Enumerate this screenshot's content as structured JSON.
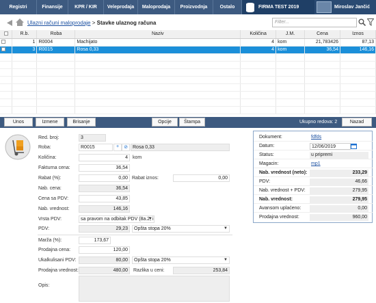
{
  "nav": [
    "Registri",
    "Finansije",
    "KPR / KIR",
    "Veleprodaja",
    "Maloprodaja",
    "Proizvodnja",
    "Ostalo"
  ],
  "firm": "FIRMA TEST 2019",
  "user": "Miroslav Jančić",
  "breadcrumb": {
    "link": "Ulazni računi maloprodaje",
    "sep": ">",
    "current": "Stavke ulaznog računa"
  },
  "filter_placeholder": "Filter...",
  "columns": [
    "R.b.",
    "Roba",
    "Naziv",
    "Količina",
    "J.M.",
    "Cena",
    "Iznos"
  ],
  "rows": [
    {
      "rb": "1",
      "roba": "R0004",
      "naziv": "Machijato",
      "kol": "4",
      "jm": "kom",
      "cena": "21,783426",
      "iznos": "87,13"
    },
    {
      "rb": "3",
      "roba": "R0015",
      "naziv": "Rosa 0,33",
      "kol": "4",
      "jm": "kom",
      "cena": "36,54",
      "iznos": "146,16"
    }
  ],
  "actions": {
    "unos": "Unos",
    "izmene": "Izmene",
    "brisanje": "Brisanje",
    "opcije": "Opcije",
    "stampa": "Štampa",
    "nazad": "Nazad",
    "total": "Ukupno redova: 2"
  },
  "form": {
    "red_broj_l": "Red. broj:",
    "red_broj": "3",
    "roba_l": "Roba:",
    "roba": "R0015",
    "roba_naziv": "Rosa 0,33",
    "kolicina_l": "Količina:",
    "kolicina": "4",
    "jm": "kom",
    "fakt_cena_l": "Fakturna cena:",
    "fakt_cena": "36,54",
    "rabat_pct_l": "Rabat (%):",
    "rabat_pct": "0,00",
    "rabat_iznos_l": "Rabat iznos:",
    "rabat_iznos": "0,00",
    "nab_cena_l": "Nab. cena:",
    "nab_cena": "36,54",
    "cena_pdv_l": "Cena sa PDV:",
    "cena_pdv": "43,85",
    "nab_vred_l": "Nab. vrednost:",
    "nab_vred": "146,16",
    "vrsta_pdv_l": "Vrsta PDV:",
    "vrsta_pdv": "sa pravom na odbitak PDV (8a.2, i",
    "pdv_l": "PDV:",
    "pdv": "29,23",
    "pdv_stopa": "Opšta stopa 20%",
    "marza_l": "Marža (%):",
    "marza": "173,67",
    "prod_cena_l": "Prodajna cena:",
    "prod_cena": "120,00",
    "ukalk_pdv_l": "Ukalkulisani PDV:",
    "ukalk_pdv": "80,00",
    "ukalk_stopa": "Opšta stopa 20%",
    "prod_vred_l": "Prodajna vrednost:",
    "prod_vred": "480,00",
    "razlika_l": "Razlika u ceni:",
    "razlika": "253,84",
    "opis_l": "Opis:"
  },
  "side": [
    {
      "k": "Dokument:",
      "v": "fdfds",
      "link": true
    },
    {
      "k": "Datum:",
      "v": "12/06/2019"
    },
    {
      "k": "Status:",
      "v": "u pripremi"
    },
    {
      "k": "Magacin:",
      "v": "mp1",
      "link": true
    },
    {
      "k": "Nab. vrednost (neto):",
      "v": "233,29",
      "bold": true
    },
    {
      "k": "PDV:",
      "v": "46,66"
    },
    {
      "k": "Nab. vrednost + PDV:",
      "v": "279,95"
    },
    {
      "k": "Nab. vrednost:",
      "v": "279,95",
      "bold": true
    },
    {
      "k": "Avansom uplaćeno:",
      "v": "0,00"
    },
    {
      "k": "Prodajna vrednost:",
      "v": "960,00"
    }
  ]
}
